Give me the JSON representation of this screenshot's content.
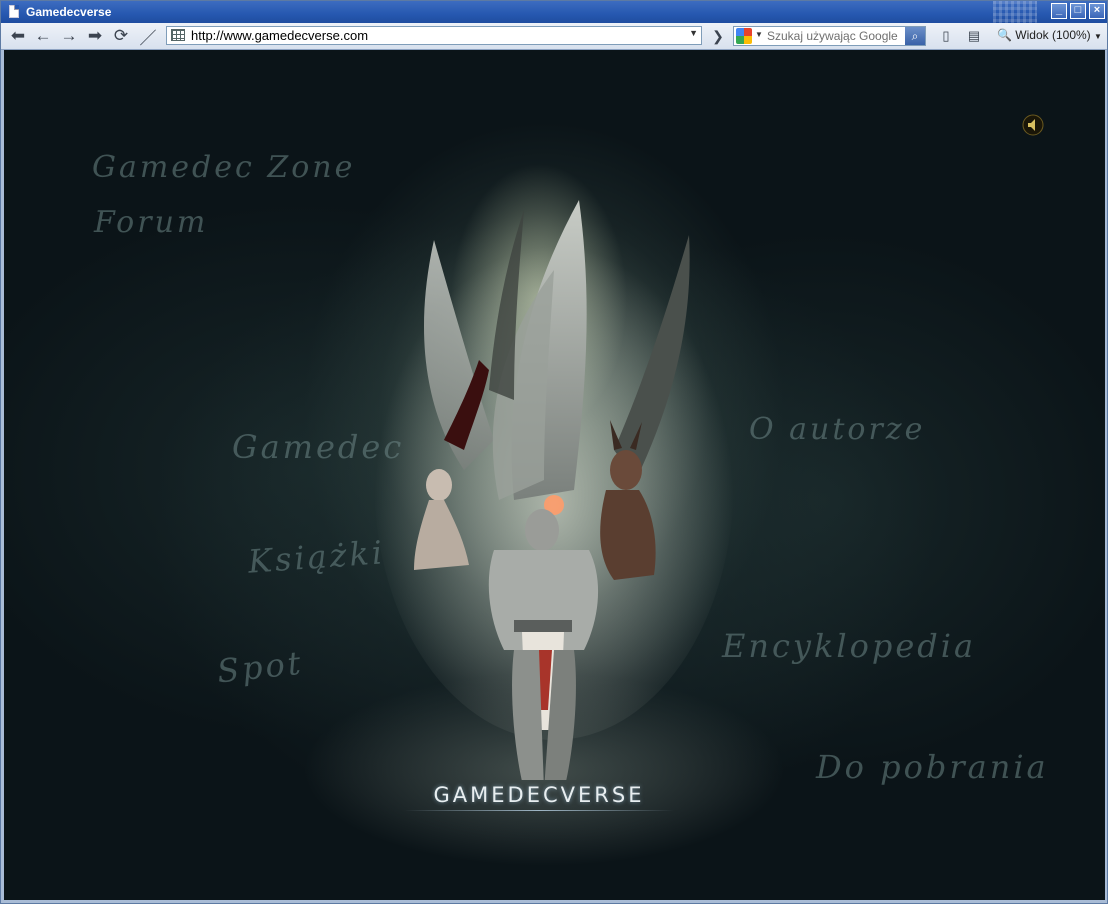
{
  "window": {
    "title": "Gamedecverse",
    "buttons": [
      "_",
      "□",
      "×"
    ]
  },
  "toolbar": {
    "url": "http://www.gamedecverse.com",
    "search_placeholder": "Szukaj używając Google",
    "zoom_label": "Widok (100%)",
    "icons": [
      "back-icon",
      "prev-icon",
      "next-icon",
      "forward-icon",
      "reload-icon",
      "edit-icon"
    ]
  },
  "page": {
    "nav_links": {
      "gamedec_zone": "Gamedec Zone",
      "forum": "Forum",
      "gamedec": "Gamedec",
      "ksiazki": "Książki",
      "spot": "Spot",
      "o_autorze": "O autorze",
      "encyklopedia": "Encyklopedia",
      "do_pobrania": "Do pobrania"
    },
    "logo_text": "GAMEDECVERSE"
  },
  "colors": {
    "titlebar": "#2658b0",
    "page_background": "#0b1418",
    "nav_text": "#6e8787"
  }
}
